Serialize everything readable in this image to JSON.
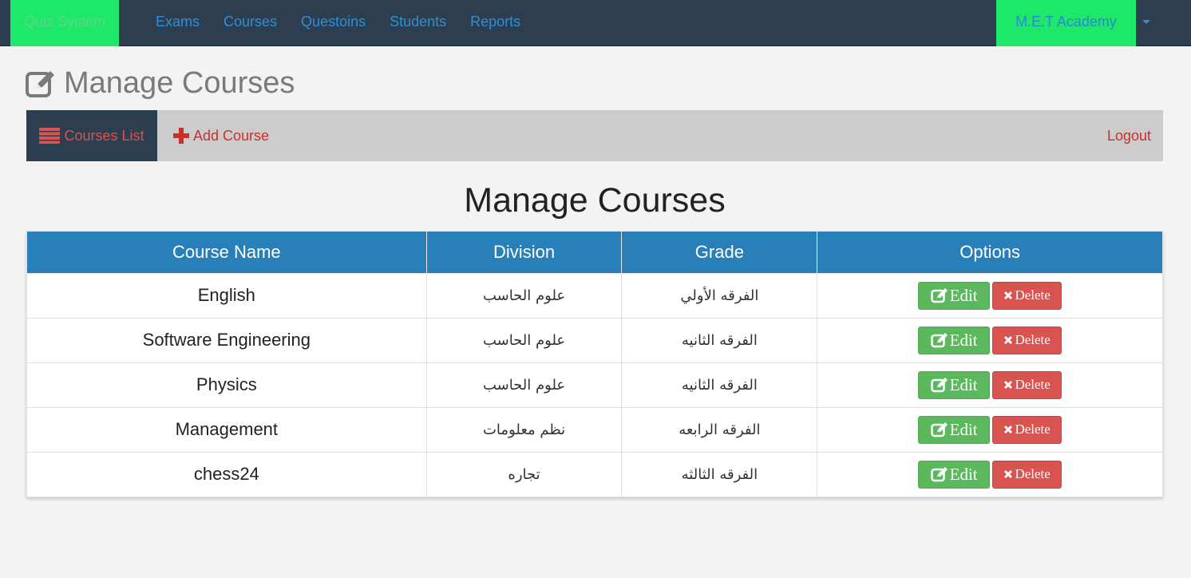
{
  "navbar": {
    "brand": "Quiz System",
    "links": [
      "Exams",
      "Courses",
      "Questoins",
      "Students",
      "Reports"
    ],
    "account": "M.E.T Academy"
  },
  "page": {
    "heading": "Manage Courses",
    "section_title": "Manage Courses"
  },
  "subnav": {
    "list_tab": "Courses List",
    "add_tab": "Add Course",
    "logout": "Logout"
  },
  "table": {
    "headers": [
      "Course Name",
      "Division",
      "Grade",
      "Options"
    ],
    "rows": [
      {
        "name": "English",
        "division": "علوم الحاسب",
        "grade": "الفرقه الأولي"
      },
      {
        "name": "Software Engineering",
        "division": "علوم الحاسب",
        "grade": "الفرقه الثانيه"
      },
      {
        "name": "Physics",
        "division": "علوم الحاسب",
        "grade": "الفرقه الثانيه"
      },
      {
        "name": "Management",
        "division": "نظم معلومات",
        "grade": "الفرقه الرابعه"
      },
      {
        "name": "chess24",
        "division": "تجاره",
        "grade": "الفرقه الثالثه"
      }
    ],
    "edit_label": "Edit",
    "delete_label": "Delete"
  },
  "colors": {
    "navbar_bg": "#2c3e50",
    "brand_bg": "#1ee86a",
    "table_header_bg": "#2980b9",
    "edit_btn": "#5cb85c",
    "delete_btn": "#d9534f"
  },
  "icons": {
    "heading_icon": "edit-icon",
    "list_tab_icon": "list-icon",
    "add_tab_icon": "plus-icon",
    "edit_icon": "edit-icon",
    "delete_icon": "close-icon",
    "account_icon": "caret-down-icon"
  }
}
